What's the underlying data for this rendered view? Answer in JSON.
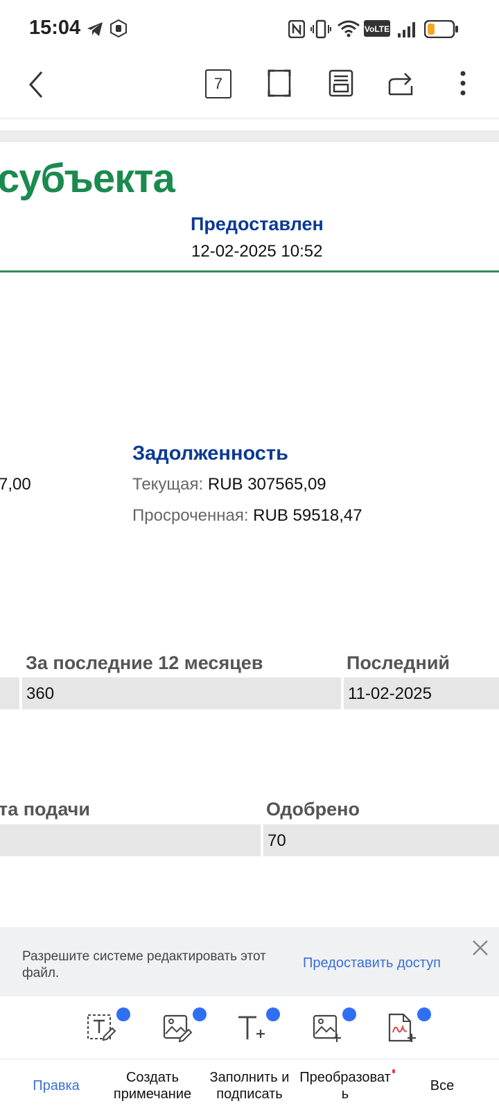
{
  "status_bar": {
    "time": "15:04"
  },
  "toolbar": {
    "page_number": "7"
  },
  "document": {
    "title_fragment": "субъекта",
    "provided_label": "Предоставлен",
    "provided_datetime": "12-02-2025 10:52",
    "debt_heading": "Задолженность",
    "left_cut_value": "7,00",
    "current_label": "Текущая:",
    "current_value": "RUB 307565,09",
    "overdue_label": "Просроченная:",
    "overdue_value": "RUB 59518,47",
    "table1": {
      "col_last12": "За последние 12 месяцев",
      "col_last": "Последний",
      "val_last12": "360",
      "val_last": "11-02-2025"
    },
    "table2": {
      "col_submit": "та подачи",
      "col_approved": "Одобрено",
      "val_approved": "70"
    }
  },
  "banner": {
    "message": "Разрешите системе редактировать этот файл.",
    "action": "Предоставить доступ"
  },
  "tools": [
    {
      "icon": "text-box-edit-icon"
    },
    {
      "icon": "image-edit-icon"
    },
    {
      "icon": "add-text-icon"
    },
    {
      "icon": "add-image-icon"
    },
    {
      "icon": "add-signature-doc-icon"
    }
  ],
  "tabs": {
    "edit": "Правка",
    "comment": "Создать примечание",
    "fill_sign": "Заполнить и подписать",
    "convert": "Преобразовать",
    "all": "Все"
  },
  "colors": {
    "accent_green": "#1b8a4f",
    "heading_blue": "#0c3a92",
    "link_blue": "#3a6fd8",
    "badge_blue": "#2f6ff2",
    "battery_orange": "#f5a623"
  }
}
